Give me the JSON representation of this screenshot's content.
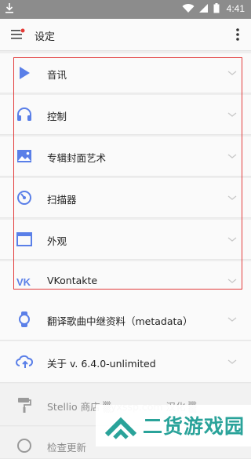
{
  "status_bar": {
    "time": "4:41"
  },
  "app_bar": {
    "title": "设定"
  },
  "colors": {
    "accent": "#5a7fe8",
    "highlight_box": "#e23b3b",
    "watermark": "#2aa39a"
  },
  "items": [
    {
      "label": "音讯",
      "icon": "play-icon"
    },
    {
      "label": "控制",
      "icon": "headphones-icon"
    },
    {
      "label": "专辑封面艺术",
      "icon": "image-icon"
    },
    {
      "label": "扫描器",
      "icon": "scanner-icon"
    },
    {
      "label": "外观",
      "icon": "window-icon"
    },
    {
      "label": "VKontakte",
      "icon": "vk-icon"
    },
    {
      "label": "翻译歌曲中继资料（metadata）",
      "icon": "watch-icon"
    },
    {
      "label": "关于 v. 6.4.0-unlimited",
      "icon": "cloud-sync-icon"
    },
    {
      "label": "Stellio 商店 ▒yxssp.com 汉化 ▒",
      "icon": "paint-roller-icon"
    },
    {
      "label": "检查更新",
      "icon": "update-icon"
    }
  ],
  "watermark": {
    "text": "二货游戏园"
  }
}
